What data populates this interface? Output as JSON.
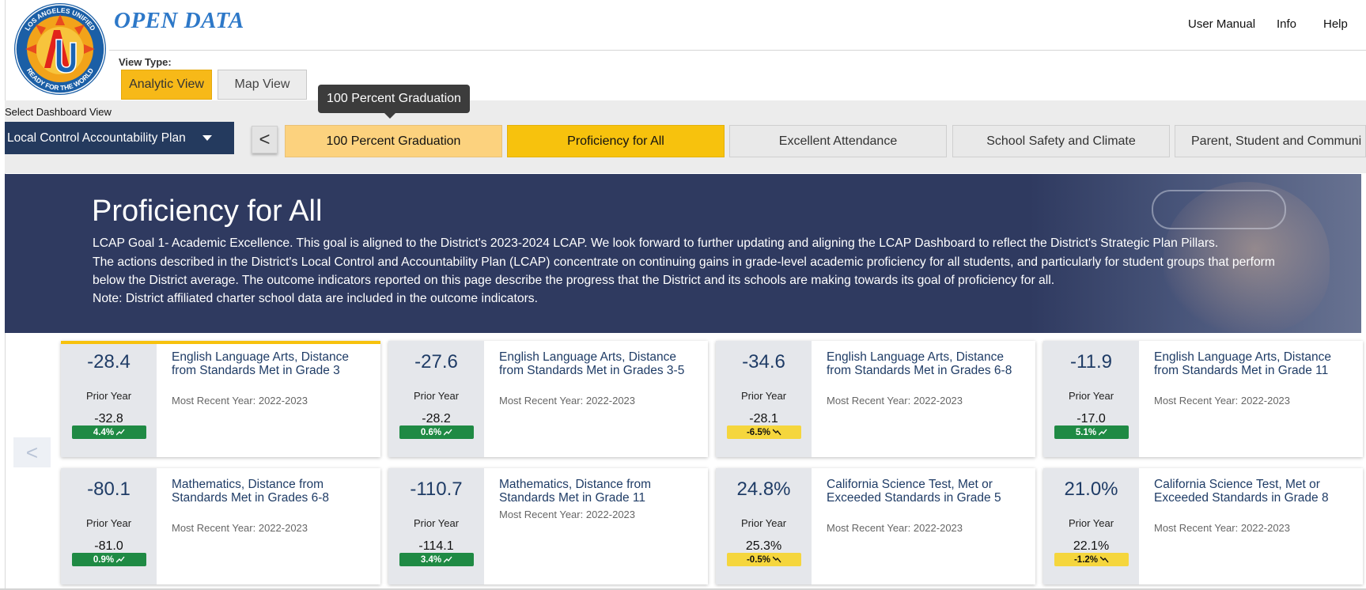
{
  "brand": {
    "logo_text_top": "LOS ANGELES UNIFIED",
    "logo_text_bottom": "READY FOR THE WORLD",
    "title": "OPEN DATA"
  },
  "top_nav": [
    {
      "label": "User Manual"
    },
    {
      "label": "Info"
    },
    {
      "label": "Help"
    }
  ],
  "view_type": {
    "label": "View Type:",
    "options": [
      {
        "label": "Analytic View",
        "selected": true
      },
      {
        "label": "Map View",
        "selected": false
      }
    ]
  },
  "dashboard": {
    "label": "Select Dashboard View",
    "selected": "Local Control Accountability Plan",
    "prev_symbol": "<",
    "tooltip": "100 Percent Graduation",
    "tabs": [
      {
        "label": "100 Percent Graduation",
        "state": "hover"
      },
      {
        "label": "Proficiency for All",
        "state": "active"
      },
      {
        "label": "Excellent Attendance",
        "state": "normal"
      },
      {
        "label": "School Safety and Climate",
        "state": "normal"
      },
      {
        "label": "Parent, Student and Communi",
        "state": "normal"
      }
    ]
  },
  "hero": {
    "title": "Proficiency for All",
    "lines": [
      "LCAP Goal 1- Academic Excellence. This goal is aligned to the District's 2023-2024 LCAP. We look forward to further updating and aligning the LCAP Dashboard to reflect the District's Strategic Plan Pillars.",
      "The actions described in the District's Local Control and Accountability Plan (LCAP) concentrate on continuing gains in grade-level academic proficiency for all students, and particularly for student groups that perform",
      "below the District average. The outcome indicators reported on this page describe the progress that the District and its schools are making towards its goal of proficiency for all.",
      "Note: District affiliated charter school data are included in the outcome indicators."
    ]
  },
  "cards_prev_symbol": "<",
  "cards": [
    {
      "value": "-28.4",
      "prior_label": "Prior Year",
      "prior_value": "-32.8",
      "change": "4.4%",
      "direction": "up",
      "title": "English Language Arts, Distance from Standards Met in Grade 3",
      "year": "Most Recent Year: 2022-2023",
      "selected": true
    },
    {
      "value": "-27.6",
      "prior_label": "Prior Year",
      "prior_value": "-28.2",
      "change": "0.6%",
      "direction": "up",
      "title": "English Language Arts, Distance from Standards Met in Grades 3-5",
      "year": "Most Recent Year: 2022-2023",
      "selected": false
    },
    {
      "value": "-34.6",
      "prior_label": "Prior Year",
      "prior_value": "-28.1",
      "change": "-6.5%",
      "direction": "down",
      "title": "English Language Arts, Distance from Standards Met in Grades 6-8",
      "year": "Most Recent Year: 2022-2023",
      "selected": false
    },
    {
      "value": "-11.9",
      "prior_label": "Prior Year",
      "prior_value": "-17.0",
      "change": "5.1%",
      "direction": "up",
      "title": "English Language Arts, Distance from Standards Met in Grade 11",
      "year": "Most Recent Year: 2022-2023",
      "selected": false
    },
    {
      "value": "-80.1",
      "prior_label": "Prior Year",
      "prior_value": "-81.0",
      "change": "0.9%",
      "direction": "up",
      "title": "Mathematics, Distance from Standards Met in Grades 6-8",
      "year": "Most Recent Year: 2022-2023",
      "selected": false
    },
    {
      "value": "-110.7",
      "prior_label": "Prior Year",
      "prior_value": "-114.1",
      "change": "3.4%",
      "direction": "up",
      "title": "Mathematics, Distance from Standards Met in Grade 11",
      "year": "Most Recent Year: 2022-2023",
      "selected": false
    },
    {
      "value": "24.8%",
      "prior_label": "Prior Year",
      "prior_value": "25.3%",
      "change": "-0.5%",
      "direction": "down",
      "title": "California Science Test, Met or Exceeded Standards in Grade 5",
      "year": "Most Recent Year: 2022-2023",
      "selected": false
    },
    {
      "value": "21.0%",
      "prior_label": "Prior Year",
      "prior_value": "22.1%",
      "change": "-1.2%",
      "direction": "down",
      "title": "California Science Test, Met or Exceeded Standards in Grade 8",
      "year": "Most Recent Year: 2022-2023",
      "selected": false
    }
  ],
  "colors": {
    "navy": "#243a5e",
    "hero": "#2f3a60",
    "accent_yellow": "#f7c20d",
    "up_green": "#1f8a44",
    "down_yellow": "#f5d63d"
  }
}
